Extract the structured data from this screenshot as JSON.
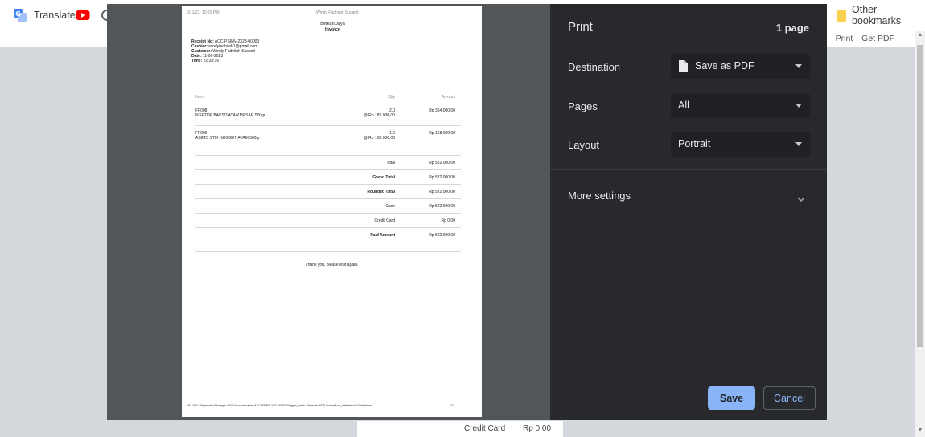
{
  "bookmarks": {
    "translate_label": "Translate",
    "other_bookmarks_label": "Other bookmarks"
  },
  "background_page": {
    "print_link": "Print",
    "get_pdf_link": "Get PDF",
    "footer_label": "Credit Card",
    "footer_value": "Rp 0,00"
  },
  "preview": {
    "header_datetime": "6/11/23, 10:29 PM",
    "header_title": "Windy Fadhilah Susanti",
    "company": "Berkah Jaya",
    "doc_title": "Invoice",
    "receipt_no_label": "Receipt No:",
    "receipt_no": "ACC-PSINV-2023-00003",
    "cashier_label": "Cashier:",
    "cashier": "windyfadhilah1@gmail.com",
    "customer_label": "Customer:",
    "customer": "Windy Fadhilah Susanti",
    "date_label": "Date:",
    "date": "11-06-2023",
    "time_label": "Time:",
    "time": "22:28:16",
    "columns": {
      "item": "Item",
      "qty": "Qty",
      "amount": "Amount"
    },
    "items": [
      {
        "code": "FF008",
        "name": "NGETOP BAKSO AYAM BESAR 500gr",
        "qty": "2.0",
        "rate": "@ Rp 182.000,00",
        "amount": "Rp 364.000,00"
      },
      {
        "code": "FF006",
        "name": "ASIMO STIK NUGGET AYAM 500gr",
        "qty": "1.0",
        "rate": "@ Rp 158.000,00",
        "amount": "Rp 158.000,00"
      }
    ],
    "totals": [
      {
        "label": "Total",
        "value": "Rp 522.000,00",
        "bold": false
      },
      {
        "label": "Grand Total",
        "value": "Rp 522.000,00",
        "bold": true
      },
      {
        "label": "Rounded Total",
        "value": "Rp 522.000,00",
        "bold": true
      },
      {
        "label": "Cash",
        "value": "Rp 522.000,00",
        "bold": false
      },
      {
        "label": "Credit Card",
        "value": "Rp 0,00",
        "bold": false
      },
      {
        "label": "Paid Amount",
        "value": "Rp 522.000,00",
        "bold": true
      }
    ],
    "thank_you": "Thank you, please visit again.",
    "footer_url": "192.168.0.8/printview?doctype=POS Invoice&name=ACC-PSINV-2023-00003&trigger_print=1&format=POS Invoice&no_letterhead=1&letterhead...",
    "footer_page": "1/1"
  },
  "panel": {
    "title": "Print",
    "page_count": "1 page",
    "destination_label": "Destination",
    "destination_value": "Save as PDF",
    "pages_label": "Pages",
    "pages_value": "All",
    "layout_label": "Layout",
    "layout_value": "Portrait",
    "more_settings_label": "More settings",
    "save_label": "Save",
    "cancel_label": "Cancel"
  },
  "colors": {
    "panel_bg": "#28292c",
    "select_bg": "#202124",
    "accent": "#8ab4f8",
    "preview_bg": "#525659"
  }
}
